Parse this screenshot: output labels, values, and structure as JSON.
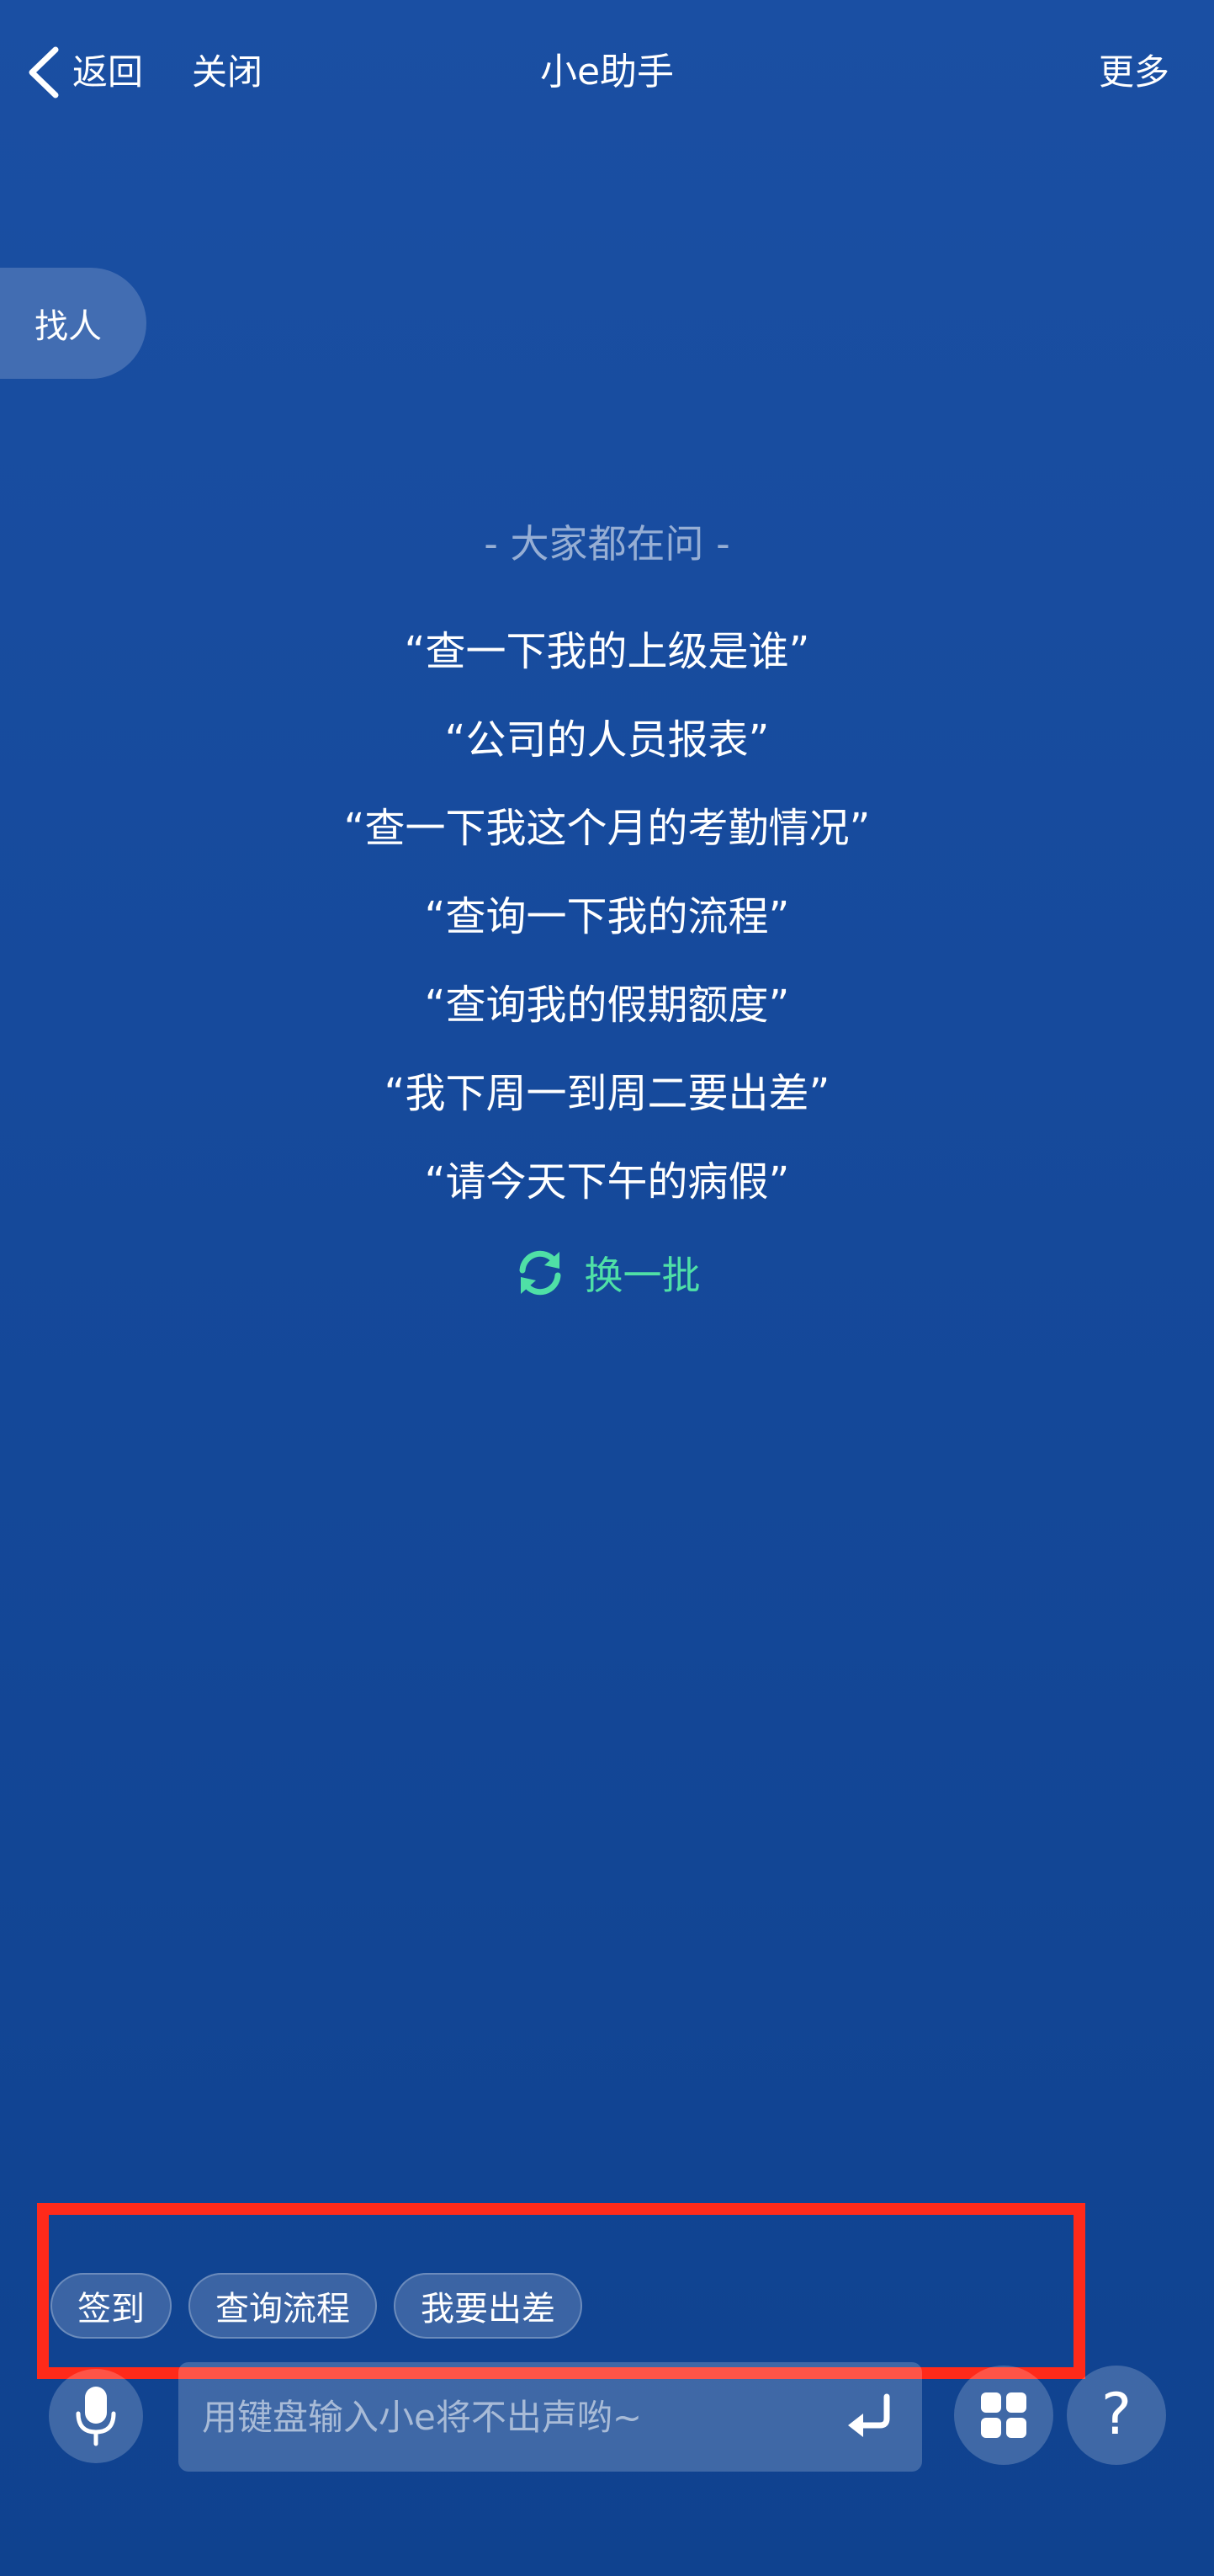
{
  "nav": {
    "back_label": "返回",
    "close_label": "关闭",
    "title": "小e助手",
    "more_label": "更多"
  },
  "side_pill": {
    "label": "找人"
  },
  "suggestions": {
    "header": "- 大家都在问 -",
    "items": [
      "“查一下我的上级是谁”",
      "“公司的人员报表”",
      "“查一下我这个月的考勤情况”",
      "“查询一下我的流程”",
      "“查询我的假期额度”",
      "“我下周一到周二要出差”",
      "“请今天下午的病假”"
    ],
    "refresh_label": "换一批",
    "refresh_icon": "refresh-icon",
    "refresh_color": "#4fe0a6"
  },
  "quick_chips": [
    "签到",
    "查询流程",
    "我要出差"
  ],
  "input": {
    "placeholder": "用键盘输入小e将不出声哟~",
    "value": ""
  },
  "icons": {
    "back": "chevron-left-icon",
    "mic": "microphone-icon",
    "enter": "enter-icon",
    "apps": "grid-icon",
    "help": "question-icon"
  },
  "help_glyph": "?",
  "colors": {
    "background_top": "#1a4fa3",
    "background_bottom": "#0f428f",
    "highlight_border": "#ff2a1a"
  }
}
